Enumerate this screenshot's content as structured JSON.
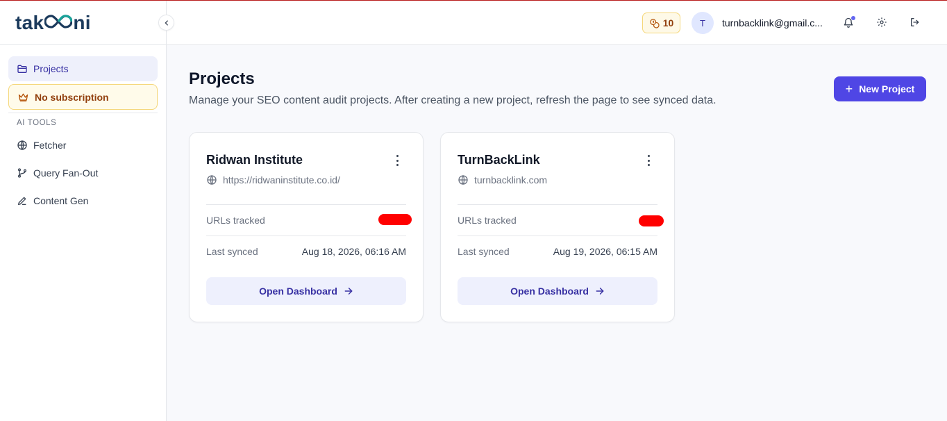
{
  "brand": {
    "logo_prefix": "tak",
    "logo_suffix": "ni"
  },
  "sidebar": {
    "items": [
      {
        "label": "Projects",
        "icon": "folder-icon",
        "active": true
      }
    ],
    "subscription": {
      "label": "No subscription",
      "icon": "crown-icon"
    },
    "section_label": "AI TOOLS",
    "tools": [
      {
        "label": "Fetcher",
        "icon": "globe-icon"
      },
      {
        "label": "Query Fan-Out",
        "icon": "git-branch-icon"
      },
      {
        "label": "Content Gen",
        "icon": "pen-icon"
      }
    ]
  },
  "header": {
    "credits": "10",
    "avatar_initial": "T",
    "email": "turnbacklink@gmail.c..."
  },
  "main": {
    "title": "Projects",
    "description": "Manage your SEO content audit projects. After creating a new project, refresh the page to see synced data.",
    "new_project_label": "New Project"
  },
  "projects": [
    {
      "name": "Ridwan Institute",
      "url": "https://ridwaninstitute.co.id/",
      "urls_tracked_label": "URLs tracked",
      "last_synced_label": "Last synced",
      "last_synced": "Aug 18, 2026, 06:16 AM",
      "open_label": "Open Dashboard"
    },
    {
      "name": "TurnBackLink",
      "url": "turnbacklink.com",
      "urls_tracked_label": "URLs tracked",
      "last_synced_label": "Last synced",
      "last_synced": "Aug 19, 2026, 06:15 AM",
      "open_label": "Open Dashboard"
    }
  ],
  "colors": {
    "accent": "#4f46e5",
    "brand": "#1b3a5c",
    "brand_loop": "#1aa39a",
    "redaction": "#ff0000"
  }
}
